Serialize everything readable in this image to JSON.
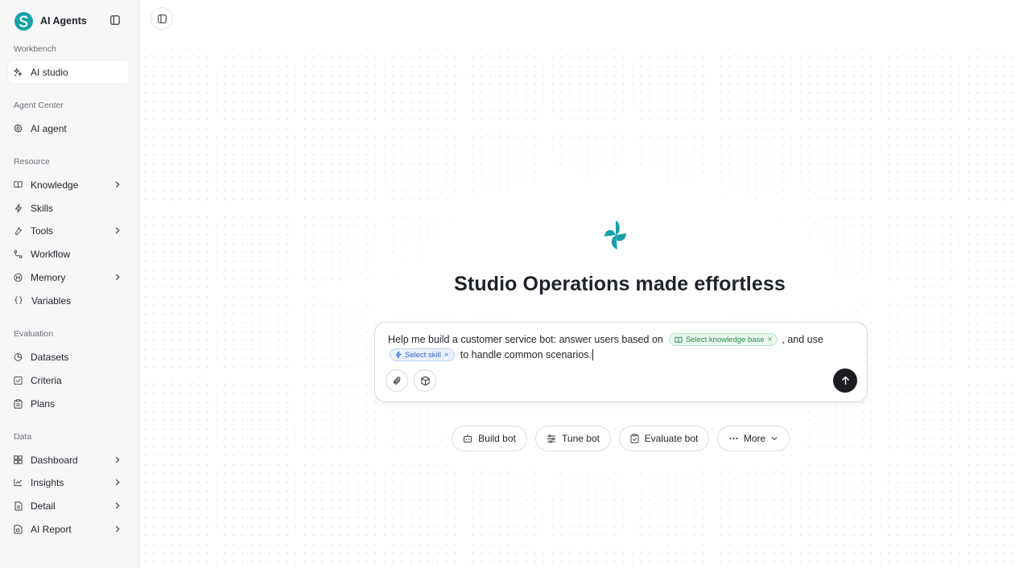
{
  "brand": {
    "name": "AI Agents",
    "logo_letter": "S",
    "accent": "#17a2a8"
  },
  "sidebar": {
    "sections": [
      {
        "label": "Workbench",
        "items": [
          {
            "label": "AI studio",
            "icon": "sparkles-icon",
            "active": true
          }
        ]
      },
      {
        "label": "Agent Center",
        "items": [
          {
            "label": "AI agent",
            "icon": "gear-icon"
          }
        ]
      },
      {
        "label": "Resource",
        "items": [
          {
            "label": "Knowledge",
            "icon": "book-icon",
            "expandable": true
          },
          {
            "label": "Skills",
            "icon": "lightning-icon"
          },
          {
            "label": "Tools",
            "icon": "wrench-icon",
            "expandable": true
          },
          {
            "label": "Workflow",
            "icon": "workflow-icon"
          },
          {
            "label": "Memory",
            "icon": "memory-icon",
            "expandable": true
          },
          {
            "label": "Variables",
            "icon": "braces-icon"
          }
        ]
      },
      {
        "label": "Evaluation",
        "items": [
          {
            "label": "Datasets",
            "icon": "pie-icon"
          },
          {
            "label": "Criteria",
            "icon": "checkbox-icon"
          },
          {
            "label": "Plans",
            "icon": "clipboard-icon"
          }
        ]
      },
      {
        "label": "Data",
        "items": [
          {
            "label": "Dashboard",
            "icon": "grid-icon",
            "expandable": true
          },
          {
            "label": "Insights",
            "icon": "line-chart-icon",
            "expandable": true
          },
          {
            "label": "Detail",
            "icon": "document-icon",
            "expandable": true
          },
          {
            "label": "AI Report",
            "icon": "report-icon",
            "expandable": true
          }
        ]
      }
    ]
  },
  "main": {
    "title": "Studio Operations made effortless",
    "composer": {
      "text_before_kb": "Help me build a customer service bot: answer users based on",
      "kb_chip": "Select knowledge base",
      "text_after_kb": ", and use",
      "skill_chip": "Select skill",
      "text_after_skill": "to handle common scenarios.",
      "chip_remove": "×"
    },
    "actions": [
      {
        "label": "Build bot",
        "icon": "robot-icon"
      },
      {
        "label": "Tune bot",
        "icon": "sliders-icon"
      },
      {
        "label": "Evaluate bot",
        "icon": "clipboard-check-icon"
      },
      {
        "label": "More",
        "icon": "ellipsis-icon"
      }
    ]
  },
  "colors": {
    "kb_chip": "#27894a",
    "skill_chip": "#2f63c8",
    "send": "#1b1c1f"
  }
}
